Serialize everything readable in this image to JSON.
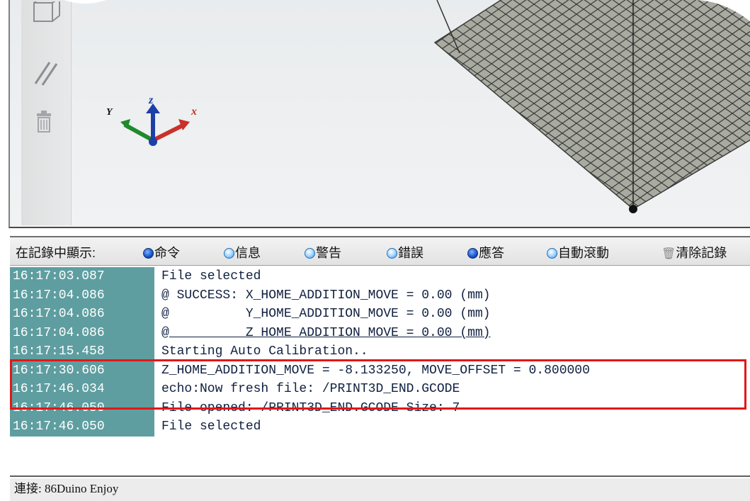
{
  "log_toolbar": {
    "label": "在記錄中顯示:",
    "filters": [
      {
        "label": "命令",
        "checked": true
      },
      {
        "label": "信息",
        "checked": false
      },
      {
        "label": "警告",
        "checked": false
      },
      {
        "label": "錯誤",
        "checked": false
      },
      {
        "label": "應答",
        "checked": true
      },
      {
        "label": "自動滾動",
        "checked": false
      }
    ],
    "clear_label": "清除記錄"
  },
  "log": [
    {
      "time": "16:17:03.087",
      "message": "File selected"
    },
    {
      "time": "16:17:04.086",
      "message": "@ SUCCESS: X_HOME_ADDITION_MOVE = 0.00 (mm)"
    },
    {
      "time": "16:17:04.086",
      "message": "@          Y_HOME_ADDITION_MOVE = 0.00 (mm)"
    },
    {
      "time": "16:17:04.086",
      "message": "@          Z_HOME_ADDITION_MOVE = 0.00 (mm)"
    },
    {
      "time": "16:17:15.458",
      "message": "Starting Auto Calibration.."
    },
    {
      "time": "16:17:30.606",
      "message": "Z_HOME_ADDITION_MOVE = -8.133250, MOVE_OFFSET = 0.800000"
    },
    {
      "time": "16:17:46.034",
      "message": "echo:Now fresh file: /PRINT3D_END.GCODE"
    },
    {
      "time": "16:17:46.050",
      "message": "File opened: /PRINT3D_END.GCODE Size: 7"
    },
    {
      "time": "16:17:46.050",
      "message": "File selected"
    }
  ],
  "axes": {
    "x": "x",
    "y": "Y",
    "z": "z"
  },
  "status_bar": {
    "connection": "連接: 86Duino Enjoy"
  },
  "colors": {
    "timestamp_bg": "#5f9ea0",
    "highlight": "#e01818",
    "plate": "#a9aaa0"
  }
}
